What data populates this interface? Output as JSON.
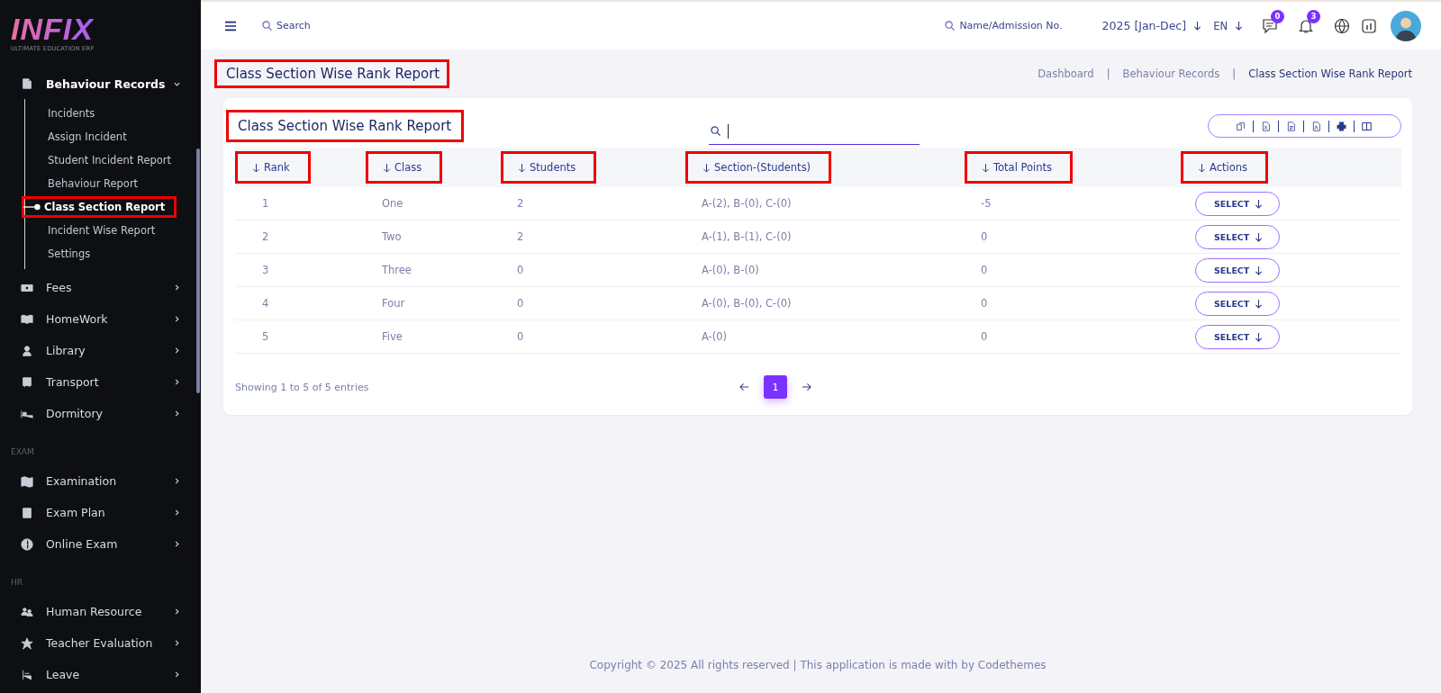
{
  "sidebar": {
    "logo": "INFIX",
    "logo_subtitle": "ULTIMATE EDUCATION ERP",
    "sections": [
      {
        "items": [
          {
            "label": "Behaviour Records",
            "expanded": true,
            "children": [
              {
                "label": "Incidents",
                "selected": false,
                "highlighted": false
              },
              {
                "label": "Assign Incident",
                "selected": false,
                "highlighted": false
              },
              {
                "label": "Student Incident Report",
                "selected": false,
                "highlighted": false
              },
              {
                "label": "Behaviour Report",
                "selected": false,
                "highlighted": false
              },
              {
                "label": "Class Section Report",
                "selected": true,
                "highlighted": true
              },
              {
                "label": "Incident Wise Report",
                "selected": false,
                "highlighted": false
              },
              {
                "label": "Settings",
                "selected": false,
                "highlighted": false
              }
            ]
          },
          {
            "label": "Fees",
            "expanded": false
          },
          {
            "label": "HomeWork",
            "expanded": false
          },
          {
            "label": "Library",
            "expanded": false
          },
          {
            "label": "Transport",
            "expanded": false
          },
          {
            "label": "Dormitory",
            "expanded": false
          }
        ]
      },
      {
        "heading": "EXAM",
        "items": [
          {
            "label": "Examination",
            "expanded": false
          },
          {
            "label": "Exam Plan",
            "expanded": false
          },
          {
            "label": "Online Exam",
            "expanded": false
          }
        ]
      },
      {
        "heading": "HR",
        "items": [
          {
            "label": "Human Resource",
            "expanded": false
          },
          {
            "label": "Teacher Evaluation",
            "expanded": false
          },
          {
            "label": "Leave",
            "expanded": false
          }
        ]
      }
    ]
  },
  "topbar": {
    "search_label": "Search",
    "student_search": "Name/Admission No.",
    "session": "2025 [Jan-Dec]",
    "language": "EN",
    "messages_count": "0",
    "notifications_count": "3"
  },
  "page": {
    "title": "Class Section Wise Rank Report",
    "title_highlighted": true,
    "breadcrumb_separator": "|",
    "breadcrumbs": [
      {
        "label": "Dashboard",
        "current": false
      },
      {
        "label": "Behaviour Records",
        "current": false
      },
      {
        "label": "Class Section Wise Rank Report",
        "current": true
      }
    ]
  },
  "card": {
    "title": "Class Section Wise Rank Report",
    "title_highlighted": true,
    "columns": [
      {
        "label": "Rank",
        "highlighted": true
      },
      {
        "label": "Class",
        "highlighted": true
      },
      {
        "label": "Students",
        "highlighted": true
      },
      {
        "label": "Section-(Students)",
        "highlighted": true
      },
      {
        "label": "Total Points",
        "highlighted": true
      },
      {
        "label": "Actions",
        "highlighted": true
      }
    ],
    "rows": [
      {
        "rank": "1",
        "class": "One",
        "students": "2",
        "sections": "A-(2), B-(0), C-(0)",
        "total_points": "-5",
        "action": "SELECT"
      },
      {
        "rank": "2",
        "class": "Two",
        "students": "2",
        "sections": "A-(1), B-(1), C-(0)",
        "total_points": "0",
        "action": "SELECT"
      },
      {
        "rank": "3",
        "class": "Three",
        "students": "0",
        "sections": "A-(0), B-(0)",
        "total_points": "0",
        "action": "SELECT"
      },
      {
        "rank": "4",
        "class": "Four",
        "students": "0",
        "sections": "A-(0), B-(0), C-(0)",
        "total_points": "0",
        "action": "SELECT"
      },
      {
        "rank": "5",
        "class": "Five",
        "students": "0",
        "sections": "A-(0)",
        "total_points": "0",
        "action": "SELECT"
      }
    ],
    "entries_info": "Showing 1 to 5 of 5 entries",
    "pages": [
      {
        "label": "1",
        "selected": true
      }
    ]
  },
  "footer": "Copyright © 2025 All rights reserved | This application is made with by Codethemes"
}
